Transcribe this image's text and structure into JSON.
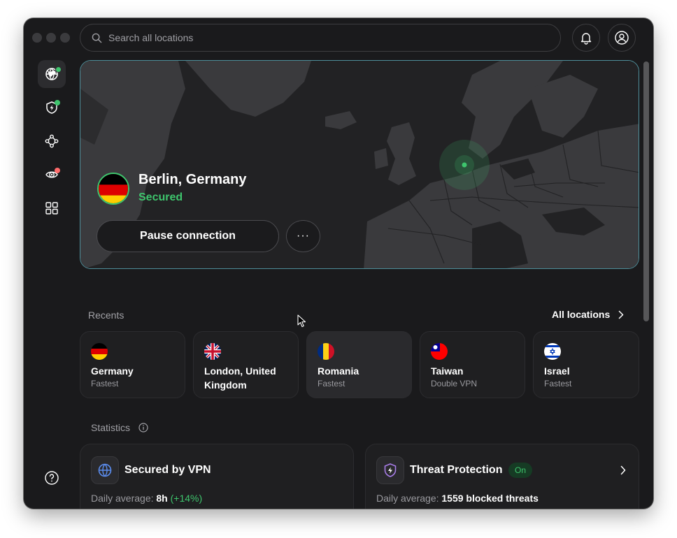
{
  "titlebar": {
    "search_placeholder": "Search all locations"
  },
  "hero": {
    "location": "Berlin, Germany",
    "status": "Secured",
    "pause_label": "Pause connection",
    "more_label": "···"
  },
  "recents": {
    "label": "Recents",
    "all_locations_label": "All locations",
    "items": [
      {
        "name": "Germany",
        "sub": "Fastest"
      },
      {
        "name": "London, United Kingdom",
        "sub": ""
      },
      {
        "name": "Romania",
        "sub": "Fastest"
      },
      {
        "name": "Taiwan",
        "sub": "Double VPN"
      },
      {
        "name": "Israel",
        "sub": "Fastest"
      }
    ]
  },
  "statistics": {
    "label": "Statistics",
    "vpn": {
      "title": "Secured by VPN",
      "daily_label": "Daily average:",
      "value": "8h",
      "change": "(+14%)"
    },
    "threat": {
      "title": "Threat Protection",
      "badge": "On",
      "daily_label": "Daily average:",
      "value": "1559 blocked threats"
    }
  },
  "colors": {
    "accent_green": "#3ec56d",
    "hero_border": "#4e8e9a",
    "window_bg": "#1a1a1c"
  },
  "icons": [
    "search-icon",
    "bell-icon",
    "account-icon",
    "globe-icon",
    "shield-bolt-icon",
    "meshnet-icon",
    "threat-eye-icon",
    "grid-icon",
    "help-icon",
    "chevron-right-icon",
    "info-icon"
  ]
}
